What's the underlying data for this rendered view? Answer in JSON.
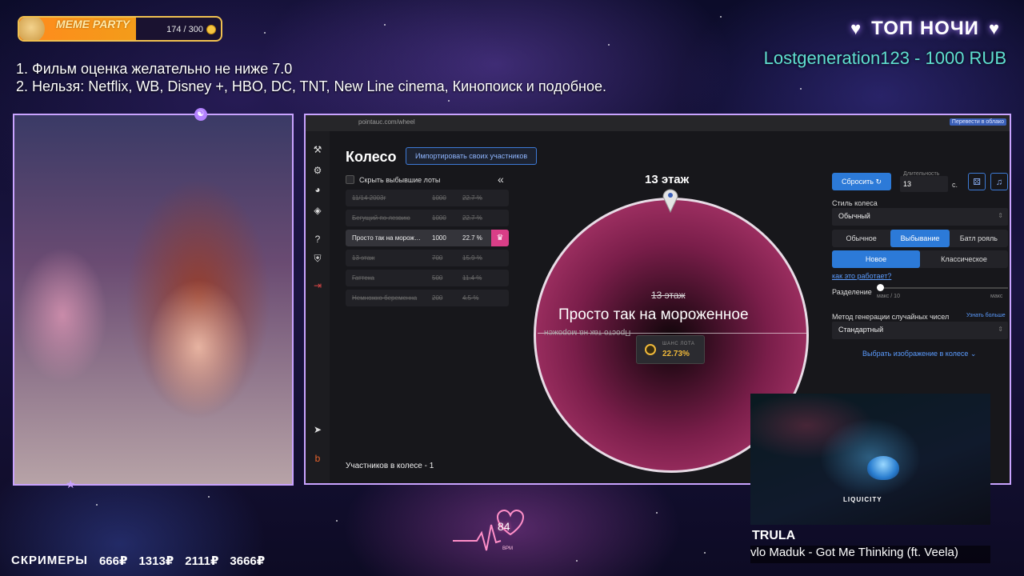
{
  "overlay": {
    "meme_party": {
      "title": "MEME PARTY",
      "count": "174 / 300",
      "progress": 0.58
    },
    "rules": [
      "1. Фильм оценка желательно не ниже 7.0",
      "2. Нельзя: Netflix, WB, Disney +, HBO, DC, TNT, New Line cinema, Кинопоиск и подобное."
    ],
    "top_night": {
      "title": "ТОП НОЧИ",
      "donor": "Lostgeneration123 - 1000 RUB"
    },
    "heart_rate": {
      "value": "84",
      "unit": "BPM"
    },
    "screamers": {
      "title": "СКРИМЕРЫ",
      "amounts": [
        "666₽",
        "1313₽",
        "2111₽",
        "3666₽"
      ]
    },
    "music": {
      "logo_text": "LIQUICITY",
      "artist": "TRULA",
      "track": "vlo Maduk - Got Me Thinking (ft. Veela)"
    }
  },
  "browser": {
    "url": "pointauc.com/wheel",
    "extension_button": "Перевести в облако"
  },
  "wheel_app": {
    "title": "Колесо",
    "import_button": "Импортировать своих участников",
    "hide_dropped_label": "Скрыть выбывшие лоты",
    "collapse_icon": "«",
    "lots": [
      {
        "name": "11/14 2003г",
        "amount": "1000",
        "pct": "22.7 %",
        "state": "struck"
      },
      {
        "name": "Бегущий по лезвию",
        "amount": "1000",
        "pct": "22.7 %",
        "state": "struck"
      },
      {
        "name": "Просто так на мороженное",
        "amount": "1000",
        "pct": "22.7 %",
        "state": "active"
      },
      {
        "name": "13 этаж",
        "amount": "700",
        "pct": "15.9 %",
        "state": "struck"
      },
      {
        "name": "Гаттека",
        "amount": "500",
        "pct": "11.4 %",
        "state": "struck"
      },
      {
        "name": "Немножко беременна",
        "amount": "200",
        "pct": "4.5 %",
        "state": "struck"
      }
    ],
    "participants": "Участников в колесе - 1",
    "wheel": {
      "top_label": "13 этаж",
      "struck_label": "13 этаж",
      "main_label": "Просто так на мороженное",
      "mirror_label": "Просто так на морожен",
      "chance_label": "ШАНС ЛОТА",
      "chance_value": "22.73%"
    },
    "settings": {
      "reset_button": "Сбросить",
      "duration_label": "Длительность",
      "duration_value": "13",
      "duration_unit": "с.",
      "style_label": "Стиль колеса",
      "style_value": "Обычный",
      "modes": [
        "Обычное",
        "Выбывание",
        "Батл рояль"
      ],
      "active_mode": "Выбывание",
      "variants": [
        "Новое",
        "Классическое"
      ],
      "active_variant": "Новое",
      "how_link": "как это работает?",
      "split_label": "Разделение",
      "split_min": "макс / 10",
      "split_max": "макс",
      "rng_label": "Метод генерации случайных чисел",
      "rng_more": "Узнать больше",
      "rng_value": "Стандартный",
      "image_link": "Выбрать изображение в колесе"
    }
  },
  "colors": {
    "accent": "#2c7ad8",
    "wheel": "#a83468",
    "frame": "#c9a3ff",
    "donor": "#5fe0d0"
  }
}
